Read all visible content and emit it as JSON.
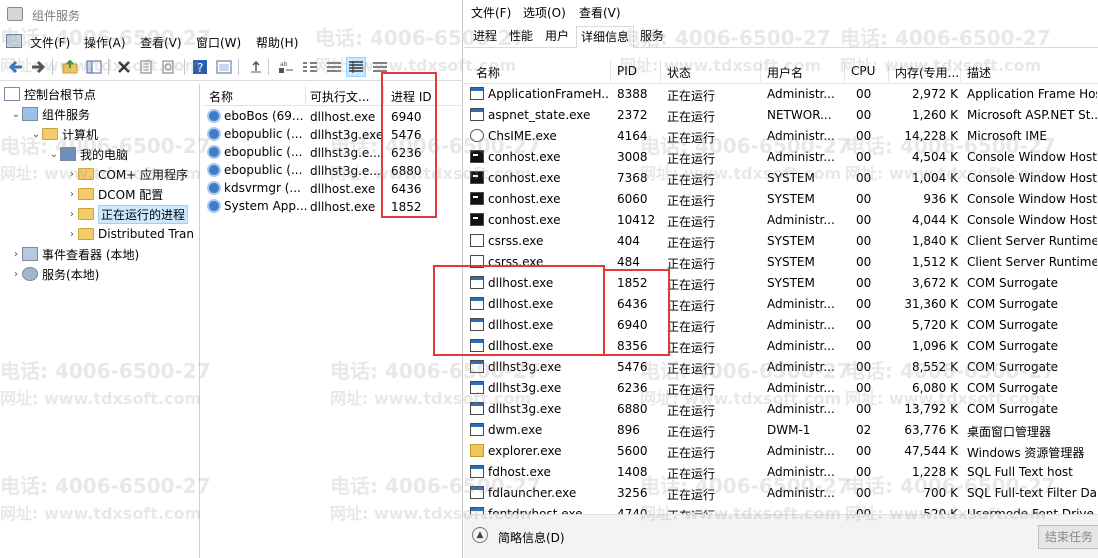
{
  "left_window": {
    "title": "组件服务",
    "menu": [
      "文件(F)",
      "操作(A)",
      "查看(V)",
      "窗口(W)",
      "帮助(H)"
    ],
    "tree": [
      {
        "label": "控制台根节点",
        "level": 0,
        "chevron": ""
      },
      {
        "label": "组件服务",
        "level": 1,
        "chevron": "⌄"
      },
      {
        "label": "计算机",
        "level": 2,
        "chevron": "⌄"
      },
      {
        "label": "我的电脑",
        "level": 3,
        "chevron": "⌄"
      },
      {
        "label": "COM+ 应用程序",
        "level": 4,
        "chevron": "›"
      },
      {
        "label": "DCOM 配置",
        "level": 4,
        "chevron": "›"
      },
      {
        "label": "正在运行的进程",
        "level": 4,
        "chevron": "›",
        "selected": true
      },
      {
        "label": "Distributed Tran",
        "level": 4,
        "chevron": "›"
      },
      {
        "label": "事件查看器 (本地)",
        "level": 0,
        "chevron": "›"
      },
      {
        "label": "服务(本地)",
        "level": 0,
        "chevron": "›"
      }
    ],
    "list_columns": [
      "名称",
      "可执行文...",
      "进程 ID"
    ],
    "list_rows": [
      {
        "name": "eboBos (69...",
        "exe": "dllhost.exe",
        "pid": "6940"
      },
      {
        "name": "ebopublic (...",
        "exe": "dllhst3g.exe",
        "pid": "5476"
      },
      {
        "name": "ebopublic (...",
        "exe": "dllhst3g.e...",
        "pid": "6236"
      },
      {
        "name": "ebopublic (...",
        "exe": "dllhst3g.e...",
        "pid": "6880"
      },
      {
        "name": "kdsvrmgr (...",
        "exe": "dllhost.exe",
        "pid": "6436"
      },
      {
        "name": "System App...",
        "exe": "dllhost.exe",
        "pid": "1852"
      }
    ]
  },
  "right_window": {
    "menu": [
      "文件(F)",
      "选项(O)",
      "查看(V)"
    ],
    "tabs": [
      "进程",
      "性能",
      "用户",
      "详细信息",
      "服务"
    ],
    "active_tab": "详细信息",
    "columns": [
      "名称",
      "PID",
      "状态",
      "用户名",
      "CPU",
      "内存(专用...",
      "描述"
    ],
    "rows": [
      {
        "name": "ApplicationFrameH...",
        "pid": "8388",
        "status": "正在运行",
        "user": "Administr...",
        "cpu": "00",
        "mem": "2,972 K",
        "desc": "Application Frame Hos",
        "icon": "win"
      },
      {
        "name": "aspnet_state.exe",
        "pid": "2372",
        "status": "正在运行",
        "user": "NETWOR...",
        "cpu": "00",
        "mem": "1,260 K",
        "desc": "Microsoft ASP.NET St...",
        "icon": "win"
      },
      {
        "name": "ChsIME.exe",
        "pid": "4164",
        "status": "正在运行",
        "user": "Administr...",
        "cpu": "00",
        "mem": "14,228 K",
        "desc": "Microsoft IME",
        "icon": "ime"
      },
      {
        "name": "conhost.exe",
        "pid": "3008",
        "status": "正在运行",
        "user": "Administr...",
        "cpu": "00",
        "mem": "4,504 K",
        "desc": "Console Window Host",
        "icon": "console"
      },
      {
        "name": "conhost.exe",
        "pid": "7368",
        "status": "正在运行",
        "user": "SYSTEM",
        "cpu": "00",
        "mem": "1,004 K",
        "desc": "Console Window Host",
        "icon": "console"
      },
      {
        "name": "conhost.exe",
        "pid": "6060",
        "status": "正在运行",
        "user": "SYSTEM",
        "cpu": "00",
        "mem": "936 K",
        "desc": "Console Window Host",
        "icon": "console"
      },
      {
        "name": "conhost.exe",
        "pid": "10412",
        "status": "正在运行",
        "user": "Administr...",
        "cpu": "00",
        "mem": "4,044 K",
        "desc": "Console Window Host",
        "icon": "console"
      },
      {
        "name": "csrss.exe",
        "pid": "404",
        "status": "正在运行",
        "user": "SYSTEM",
        "cpu": "00",
        "mem": "1,840 K",
        "desc": "Client Server Runtime ...",
        "icon": "blank"
      },
      {
        "name": "csrss.exe",
        "pid": "484",
        "status": "正在运行",
        "user": "SYSTEM",
        "cpu": "00",
        "mem": "1,512 K",
        "desc": "Client Server Runtime ...",
        "icon": "blank"
      },
      {
        "name": "dllhost.exe",
        "pid": "1852",
        "status": "正在运行",
        "user": "SYSTEM",
        "cpu": "00",
        "mem": "3,672 K",
        "desc": "COM Surrogate",
        "icon": "win"
      },
      {
        "name": "dllhost.exe",
        "pid": "6436",
        "status": "正在运行",
        "user": "Administr...",
        "cpu": "00",
        "mem": "31,360 K",
        "desc": "COM Surrogate",
        "icon": "win"
      },
      {
        "name": "dllhost.exe",
        "pid": "6940",
        "status": "正在运行",
        "user": "Administr...",
        "cpu": "00",
        "mem": "5,720 K",
        "desc": "COM Surrogate",
        "icon": "win"
      },
      {
        "name": "dllhost.exe",
        "pid": "8356",
        "status": "正在运行",
        "user": "Administr...",
        "cpu": "00",
        "mem": "1,096 K",
        "desc": "COM Surrogate",
        "icon": "win"
      },
      {
        "name": "dllhst3g.exe",
        "pid": "5476",
        "status": "正在运行",
        "user": "Administr...",
        "cpu": "00",
        "mem": "8,552 K",
        "desc": "COM Surrogate",
        "icon": "win"
      },
      {
        "name": "dllhst3g.exe",
        "pid": "6236",
        "status": "正在运行",
        "user": "Administr...",
        "cpu": "00",
        "mem": "6,080 K",
        "desc": "COM Surrogate",
        "icon": "win"
      },
      {
        "name": "dllhst3g.exe",
        "pid": "6880",
        "status": "正在运行",
        "user": "Administr...",
        "cpu": "00",
        "mem": "13,792 K",
        "desc": "COM Surrogate",
        "icon": "win"
      },
      {
        "name": "dwm.exe",
        "pid": "896",
        "status": "正在运行",
        "user": "DWM-1",
        "cpu": "02",
        "mem": "63,776 K",
        "desc": "桌面窗口管理器",
        "icon": "win"
      },
      {
        "name": "explorer.exe",
        "pid": "5600",
        "status": "正在运行",
        "user": "Administr...",
        "cpu": "00",
        "mem": "47,544 K",
        "desc": "Windows 资源管理器",
        "icon": "folder"
      },
      {
        "name": "fdhost.exe",
        "pid": "1408",
        "status": "正在运行",
        "user": "Administr...",
        "cpu": "00",
        "mem": "1,228 K",
        "desc": "SQL Full Text host",
        "icon": "win"
      },
      {
        "name": "fdlauncher.exe",
        "pid": "3256",
        "status": "正在运行",
        "user": "Administr...",
        "cpu": "00",
        "mem": "700 K",
        "desc": "SQL Full-text Filter Da...",
        "icon": "win"
      },
      {
        "name": "fontdrvhost.exe",
        "pid": "4740",
        "status": "正在运行",
        "user": "",
        "cpu": "00",
        "mem": "520 K",
        "desc": "Usermode Font Drive",
        "icon": "win"
      }
    ],
    "footer": {
      "details_label": "简略信息(D)",
      "end_task": "结束任务"
    }
  },
  "watermark": {
    "phone": "电话: 4006-6500-27",
    "site": "网址: www.tdxsoft.com"
  },
  "colors": {
    "highlight": "#e23a3a",
    "selection": "#cce8ff"
  }
}
